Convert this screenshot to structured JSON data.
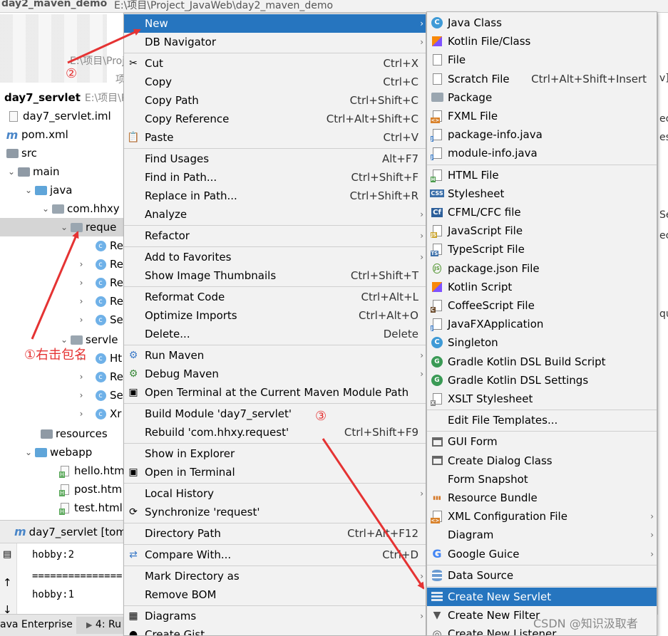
{
  "top_tabs": {
    "project": "day2_maven_demo",
    "path": "E:\\项目\\Project_JavaWeb\\day2_maven_demo"
  },
  "tree": {
    "row_partial_path1": "E:\\项目\\Proj",
    "row_partial_path2": "项",
    "module": {
      "label": "day7_servlet",
      "path": "E:\\项目\\Pr"
    },
    "items": [
      {
        "label": "day7_servlet.iml"
      },
      {
        "label": "pom.xml"
      },
      {
        "label": "src"
      },
      {
        "label": "main"
      },
      {
        "label": "java"
      },
      {
        "label": "com.hhxy"
      },
      {
        "label": "reque"
      },
      {
        "label": "Re"
      },
      {
        "label": "Re"
      },
      {
        "label": "Re"
      },
      {
        "label": "Re"
      },
      {
        "label": "Se"
      },
      {
        "label": "servle"
      },
      {
        "label": "Ht"
      },
      {
        "label": "Re"
      },
      {
        "label": "Se"
      },
      {
        "label": "Xr"
      },
      {
        "label": "resources"
      },
      {
        "label": "webapp"
      },
      {
        "label": "hello.htm"
      },
      {
        "label": "post.htm"
      },
      {
        "label": "test.html"
      }
    ]
  },
  "run_panel": {
    "title": "day7_servlet [tom",
    "lines": [
      "hobby:2",
      "===============",
      "hobby:1"
    ]
  },
  "status_bar": {
    "left": "ava Enterprise",
    "run": "4: Ru"
  },
  "editor_fragments": [
    "v]",
    "ec",
    "es",
    "Se",
    "ec",
    "qu"
  ],
  "context_menu": {
    "items": [
      {
        "label": "New",
        "shortcut": "",
        "submenu": true,
        "active": true,
        "icon": ""
      },
      {
        "label": "DB Navigator",
        "shortcut": "",
        "submenu": true,
        "icon": ""
      },
      {
        "sep": true
      },
      {
        "label": "Cut",
        "shortcut": "Ctrl+X",
        "icon": "scissors-icon"
      },
      {
        "label": "Copy",
        "shortcut": "Ctrl+C",
        "icon": ""
      },
      {
        "label": "Copy Path",
        "shortcut": "Ctrl+Shift+C",
        "icon": ""
      },
      {
        "label": "Copy Reference",
        "shortcut": "Ctrl+Alt+Shift+C",
        "icon": ""
      },
      {
        "label": "Paste",
        "shortcut": "Ctrl+V",
        "icon": "clipboard-icon"
      },
      {
        "sep": true
      },
      {
        "label": "Find Usages",
        "shortcut": "Alt+F7",
        "icon": ""
      },
      {
        "label": "Find in Path...",
        "shortcut": "Ctrl+Shift+F",
        "icon": ""
      },
      {
        "label": "Replace in Path...",
        "shortcut": "Ctrl+Shift+R",
        "icon": ""
      },
      {
        "label": "Analyze",
        "shortcut": "",
        "submenu": true,
        "icon": ""
      },
      {
        "sep": true
      },
      {
        "label": "Refactor",
        "shortcut": "",
        "submenu": true,
        "icon": ""
      },
      {
        "sep": true
      },
      {
        "label": "Add to Favorites",
        "shortcut": "",
        "submenu": true,
        "icon": ""
      },
      {
        "label": "Show Image Thumbnails",
        "shortcut": "Ctrl+Shift+T",
        "icon": ""
      },
      {
        "sep": true
      },
      {
        "label": "Reformat Code",
        "shortcut": "Ctrl+Alt+L",
        "icon": ""
      },
      {
        "label": "Optimize Imports",
        "shortcut": "Ctrl+Alt+O",
        "icon": ""
      },
      {
        "label": "Delete...",
        "shortcut": "Delete",
        "icon": ""
      },
      {
        "sep": true
      },
      {
        "label": "Run Maven",
        "shortcut": "",
        "submenu": true,
        "icon": "gear-icon"
      },
      {
        "label": "Debug Maven",
        "shortcut": "",
        "submenu": true,
        "icon": "debug-gear-icon"
      },
      {
        "label": "Open Terminal at the Current Maven Module Path",
        "shortcut": "",
        "icon": "terminal-icon"
      },
      {
        "sep": true
      },
      {
        "label": "Build Module 'day7_servlet'",
        "shortcut": "",
        "icon": ""
      },
      {
        "label": "Rebuild 'com.hhxy.request'",
        "shortcut": "Ctrl+Shift+F9",
        "icon": ""
      },
      {
        "sep": true
      },
      {
        "label": "Show in Explorer",
        "shortcut": "",
        "icon": ""
      },
      {
        "label": "Open in Terminal",
        "shortcut": "",
        "icon": "terminal-icon"
      },
      {
        "sep": true
      },
      {
        "label": "Local History",
        "shortcut": "",
        "submenu": true,
        "icon": ""
      },
      {
        "label": "Synchronize 'request'",
        "shortcut": "",
        "icon": "sync-icon"
      },
      {
        "sep": true
      },
      {
        "label": "Directory Path",
        "shortcut": "Ctrl+Alt+F12",
        "icon": ""
      },
      {
        "sep": true
      },
      {
        "label": "Compare With...",
        "shortcut": "Ctrl+D",
        "icon": "compare-icon"
      },
      {
        "sep": true
      },
      {
        "label": "Mark Directory as",
        "shortcut": "",
        "submenu": true,
        "icon": ""
      },
      {
        "label": "Remove BOM",
        "shortcut": "",
        "icon": ""
      },
      {
        "sep": true
      },
      {
        "label": "Diagrams",
        "shortcut": "",
        "submenu": true,
        "icon": "diagram-icon"
      },
      {
        "label": "Create Gist...",
        "shortcut": "",
        "icon": "github-icon"
      }
    ]
  },
  "new_submenu": {
    "items": [
      {
        "label": "Java Class",
        "icon": "java-class-icon"
      },
      {
        "label": "Kotlin File/Class",
        "icon": "kotlin-icon"
      },
      {
        "label": "File",
        "icon": "file-icon"
      },
      {
        "label": "Scratch File",
        "shortcut": "Ctrl+Alt+Shift+Insert",
        "icon": "scratch-file-icon"
      },
      {
        "label": "Package",
        "icon": "package-icon"
      },
      {
        "label": "FXML File",
        "icon": "fxml-icon"
      },
      {
        "label": "package-info.java",
        "icon": "java-file-icon"
      },
      {
        "label": "module-info.java",
        "icon": "java-file-icon"
      },
      {
        "sep": true
      },
      {
        "label": "HTML File",
        "icon": "html-icon"
      },
      {
        "label": "Stylesheet",
        "icon": "css-icon"
      },
      {
        "label": "CFML/CFC file",
        "icon": "cfml-icon"
      },
      {
        "label": "JavaScript File",
        "icon": "js-icon"
      },
      {
        "label": "TypeScript File",
        "icon": "ts-icon"
      },
      {
        "label": "package.json File",
        "icon": "nodejs-icon"
      },
      {
        "label": "Kotlin Script",
        "icon": "kotlin-icon"
      },
      {
        "label": "CoffeeScript File",
        "icon": "coffee-icon"
      },
      {
        "label": "JavaFXApplication",
        "icon": "java-file-icon"
      },
      {
        "label": "Singleton",
        "icon": "java-class-icon"
      },
      {
        "label": "Gradle Kotlin DSL Build Script",
        "icon": "gradle-icon"
      },
      {
        "label": "Gradle Kotlin DSL Settings",
        "icon": "gradle-icon"
      },
      {
        "label": "XSLT Stylesheet",
        "icon": "xslt-icon"
      },
      {
        "sep": true
      },
      {
        "label": "Edit File Templates...",
        "icon": ""
      },
      {
        "sep": true
      },
      {
        "label": "GUI Form",
        "icon": "gui-form-icon"
      },
      {
        "label": "Create Dialog Class",
        "icon": "dialog-icon"
      },
      {
        "label": "Form Snapshot",
        "icon": ""
      },
      {
        "label": "Resource Bundle",
        "icon": "resource-bundle-icon"
      },
      {
        "label": "XML Configuration File",
        "submenu": true,
        "icon": "xml-icon"
      },
      {
        "label": "Diagram",
        "submenu": true,
        "icon": ""
      },
      {
        "label": "Google Guice",
        "submenu": true,
        "icon": "google-icon"
      },
      {
        "sep": true
      },
      {
        "label": "Data Source",
        "icon": "data-source-icon"
      },
      {
        "sep": true
      },
      {
        "label": "Create New Servlet",
        "icon": "servlet-icon",
        "active": true
      },
      {
        "label": "Create New Filter",
        "icon": "filter-icon"
      },
      {
        "label": "Create New Listener",
        "icon": "listener-icon"
      }
    ]
  },
  "annotations": {
    "step1": "①右击包名",
    "step2": "②",
    "step3": "③",
    "watermark": "CSDN @知识汲取者"
  },
  "colors": {
    "menu_highlight": "#2675bf",
    "annotation_red": "#e53333"
  }
}
